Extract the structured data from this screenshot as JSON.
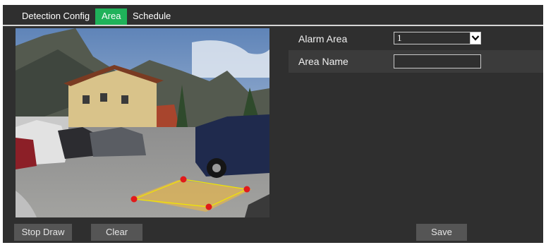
{
  "tabs": [
    {
      "label": "Detection Config",
      "active": false
    },
    {
      "label": "Area",
      "active": true
    },
    {
      "label": "Schedule",
      "active": false
    }
  ],
  "colors": {
    "active_tab": "#1fb25a",
    "panel_bg": "#2f2f2f",
    "button_bg": "#555555",
    "area_line": "#f2e600",
    "area_point": "#e11a1a"
  },
  "form": {
    "alarm_area_label": "Alarm Area",
    "alarm_area_value": "1",
    "area_name_label": "Area Name",
    "area_name_value": ""
  },
  "buttons": {
    "stop_draw": "Stop Draw",
    "clear": "Clear",
    "save": "Save"
  },
  "icons": {
    "select_arrow": "chevron-down-icon",
    "area_point": "red-dot-handle"
  }
}
